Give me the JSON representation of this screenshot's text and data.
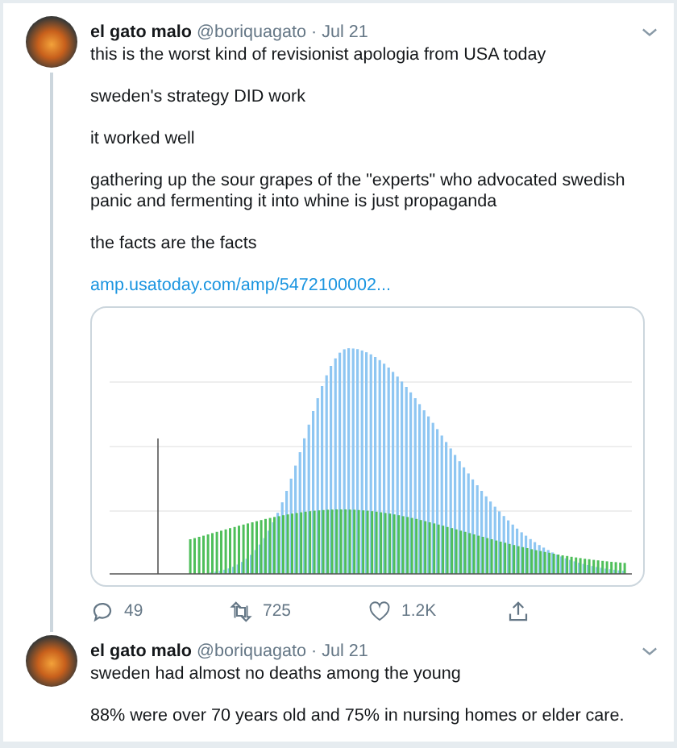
{
  "tweets": [
    {
      "author": "el gato malo",
      "handle": "@boriquagato",
      "separator": "·",
      "date": "Jul 21",
      "paragraphs": [
        "this is the worst kind of revisionist apologia from USA today",
        "sweden's strategy DID work",
        "it worked well",
        "gathering up the sour grapes of the \"experts\" who advocated swedish panic and fermenting it into whine is just propaganda",
        "the facts are the facts"
      ],
      "link": "amp.usatoday.com/amp/5472100002...",
      "media": {
        "kind": "image"
      },
      "actions": {
        "replies": "49",
        "retweets": "725",
        "likes": "1.2K"
      },
      "thread_continues": true
    },
    {
      "author": "el gato malo",
      "handle": "@boriquagato",
      "separator": "·",
      "date": "Jul 21",
      "paragraphs": [
        "sweden had almost no deaths among the young",
        "88% were over 70 years old and 75% in nursing homes or elder care."
      ],
      "thread_continues": false
    }
  ]
}
